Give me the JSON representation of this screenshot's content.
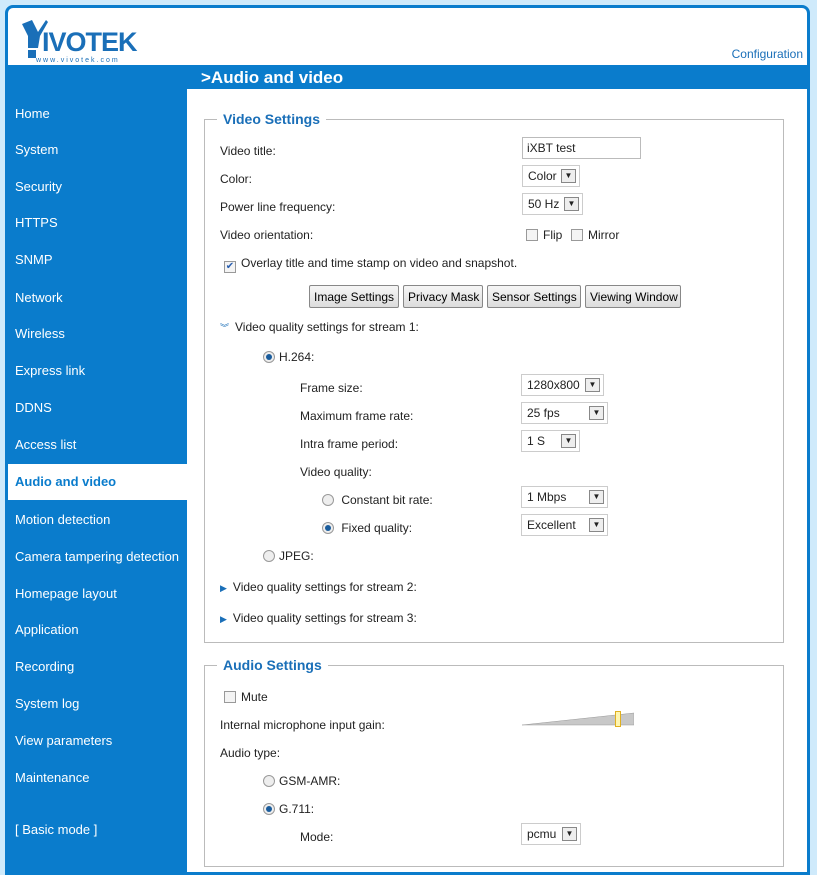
{
  "brand": {
    "name": "VIVOTEK",
    "url_text": "www.vivotek.com"
  },
  "header": {
    "configuration_link": "Configuration",
    "page_title": ">Audio and video"
  },
  "sidebar": {
    "items": [
      {
        "label": "Home"
      },
      {
        "label": "System"
      },
      {
        "label": "Security"
      },
      {
        "label": "HTTPS"
      },
      {
        "label": "SNMP"
      },
      {
        "label": "Network"
      },
      {
        "label": "Wireless"
      },
      {
        "label": "Express link"
      },
      {
        "label": "DDNS"
      },
      {
        "label": "Access list"
      },
      {
        "label": "Audio and video",
        "active": true
      },
      {
        "label": "Motion detection"
      },
      {
        "label": "Camera tampering detection"
      },
      {
        "label": "Homepage layout"
      },
      {
        "label": "Application"
      },
      {
        "label": "Recording"
      },
      {
        "label": "System log"
      },
      {
        "label": "View parameters"
      },
      {
        "label": "Maintenance"
      },
      {
        "label": "[ Basic mode ]"
      }
    ]
  },
  "video": {
    "legend": "Video Settings",
    "title_label": "Video title:",
    "title_value": "iXBT test",
    "color_label": "Color:",
    "color_value": "Color",
    "power_label": "Power line frequency:",
    "power_value": "50 Hz",
    "orientation_label": "Video orientation:",
    "flip_label": "Flip",
    "flip_checked": false,
    "mirror_label": "Mirror",
    "mirror_checked": false,
    "overlay_label": "Overlay title and time stamp on video and snapshot.",
    "overlay_checked": true,
    "buttons": [
      "Image Settings",
      "Privacy Mask",
      "Sensor Settings",
      "Viewing Window"
    ],
    "stream1": {
      "label": "Video quality settings for stream 1:",
      "expanded": true,
      "h264_label": "H.264:",
      "h264_selected": true,
      "frame_size_label": "Frame size:",
      "frame_size_value": "1280x800",
      "max_rate_label": "Maximum frame rate:",
      "max_rate_value": "25 fps",
      "intra_label": "Intra frame period:",
      "intra_value": "1 S",
      "quality_label": "Video quality:",
      "cbr_label": "Constant bit rate:",
      "cbr_selected": false,
      "cbr_value": "1 Mbps",
      "fixed_label": "Fixed quality:",
      "fixed_selected": true,
      "fixed_value": "Excellent",
      "jpeg_label": "JPEG:",
      "jpeg_selected": false
    },
    "stream2_label": "Video quality settings for stream 2:",
    "stream3_label": "Video quality settings for stream 3:"
  },
  "audio": {
    "legend": "Audio Settings",
    "mute_label": "Mute",
    "mute_checked": false,
    "gain_label": "Internal microphone input gain:",
    "gain_fraction": 0.88,
    "type_label": "Audio type:",
    "gsm_label": "GSM-AMR:",
    "gsm_selected": false,
    "g711_label": "G.711:",
    "g711_selected": true,
    "mode_label": "Mode:",
    "mode_value": "pcmu"
  },
  "colors": {
    "brand_blue": "#0a7ccc",
    "legend_blue": "#1a6fb8",
    "page_bg": "#cfeafb"
  }
}
